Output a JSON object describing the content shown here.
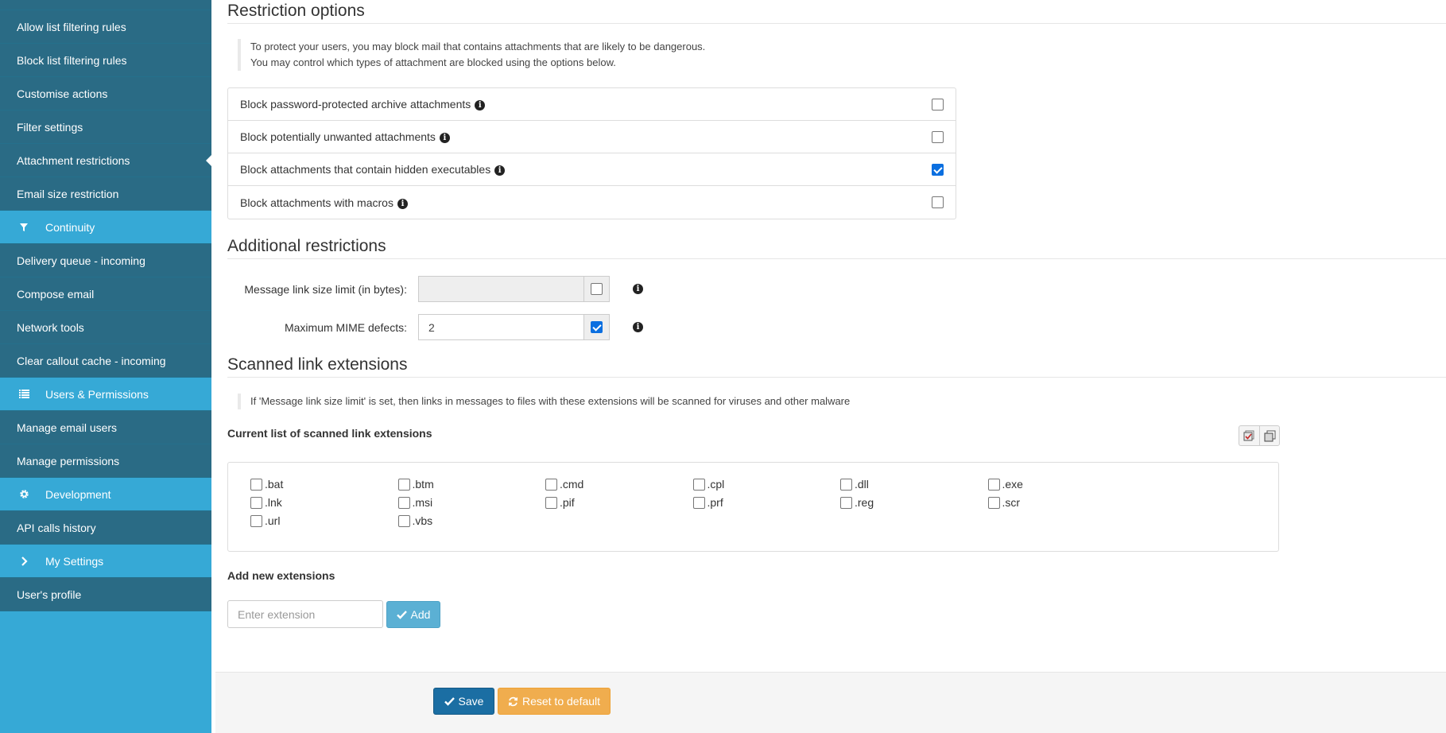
{
  "sidebar": {
    "items": [
      {
        "label": "",
        "type": "sub"
      },
      {
        "label": "Allow list filtering rules",
        "type": "sub"
      },
      {
        "label": "Block list filtering rules",
        "type": "sub"
      },
      {
        "label": "Customise actions",
        "type": "sub"
      },
      {
        "label": "Filter settings",
        "type": "sub"
      },
      {
        "label": "Attachment restrictions",
        "type": "sub",
        "active": true
      },
      {
        "label": "Email size restriction",
        "type": "sub"
      },
      {
        "label": "Continuity",
        "type": "cat",
        "icon": "filter-icon"
      },
      {
        "label": "Delivery queue - incoming",
        "type": "sub"
      },
      {
        "label": "Compose email",
        "type": "sub"
      },
      {
        "label": "Network tools",
        "type": "sub"
      },
      {
        "label": "Clear callout cache - incoming",
        "type": "sub"
      },
      {
        "label": "Users & Permissions",
        "type": "cat",
        "icon": "list-icon"
      },
      {
        "label": "Manage email users",
        "type": "sub"
      },
      {
        "label": "Manage permissions",
        "type": "sub"
      },
      {
        "label": "Development",
        "type": "cat",
        "icon": "gear-icon"
      },
      {
        "label": "API calls history",
        "type": "sub"
      },
      {
        "label": "My Settings",
        "type": "cat",
        "icon": "chevron-right-icon"
      },
      {
        "label": "User's profile",
        "type": "sub"
      }
    ]
  },
  "restriction": {
    "title": "Restriction options",
    "note_line1": "To protect your users, you may block mail that contains attachments that are likely to be dangerous.",
    "note_line2": "You may control which types of attachment are blocked using the options below.",
    "options": [
      {
        "label": "Block password-protected archive attachments",
        "checked": false
      },
      {
        "label": "Block potentially unwanted attachments",
        "checked": false
      },
      {
        "label": "Block attachments that contain hidden executables",
        "checked": true
      },
      {
        "label": "Block attachments with macros",
        "checked": false
      }
    ]
  },
  "additional": {
    "title": "Additional restrictions",
    "link_size_label": "Message link size limit (in bytes):",
    "link_size_value": "",
    "link_size_checked": false,
    "mime_label": "Maximum MIME defects:",
    "mime_value": "2",
    "mime_checked": true
  },
  "scanned": {
    "title": "Scanned link extensions",
    "note": "If 'Message link size limit' is set, then links in messages to files with these extensions will be scanned for viruses and other malware",
    "current_label": "Current list of scanned link extensions",
    "extensions": [
      ".bat",
      ".btm",
      ".cmd",
      ".cpl",
      ".dll",
      ".exe",
      ".lnk",
      ".msi",
      ".pif",
      ".prf",
      ".reg",
      ".scr",
      ".url",
      ".vbs"
    ],
    "add_label": "Add new extensions",
    "add_placeholder": "Enter extension",
    "add_button": "Add"
  },
  "footer": {
    "save": "Save",
    "reset": "Reset to default"
  },
  "colors": {
    "sidebar_category": "#36a9d6",
    "sidebar_sub": "#2a6b85",
    "save": "#1b6ea3",
    "reset": "#f0ad4e",
    "add": "#5bb0d4",
    "checkbox_checked": "#0b6fe0"
  }
}
